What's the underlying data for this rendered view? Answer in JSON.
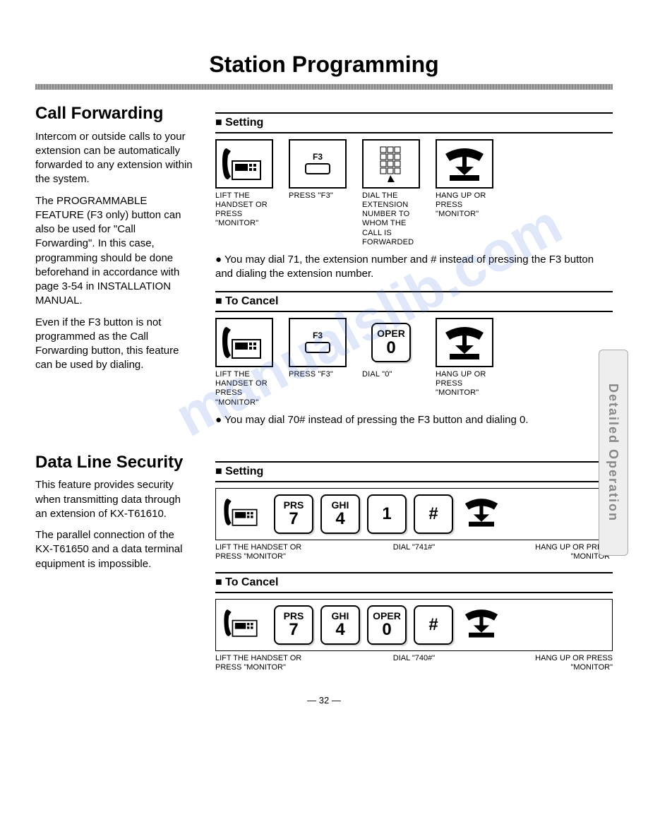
{
  "page_title": "Station Programming",
  "side_tab": "Detailed Operation",
  "watermark": "manualslib.com",
  "page_number": "— 32 —",
  "captions": {
    "lift_handset": "LIFT THE HANDSET OR PRESS \"MONITOR\"",
    "press_f3": "PRESS \"F3\"",
    "dial_ext": "DIAL THE EXTENSION NUMBER TO WHOM THE CALL IS FORWARDED",
    "hang_up": "HANG UP OR PRESS \"MONITOR\"",
    "dial_0": "DIAL \"0\"",
    "dial_741": "DIAL \"741#\"",
    "dial_740": "DIAL \"740#\""
  },
  "call_fwd": {
    "title": "Call Forwarding",
    "intro_p1": "Intercom or outside calls to your extension can be automatically forwarded to any extension within the system.",
    "intro_p2": "The PROGRAMMABLE FEATURE (F3 only) button can also be used for \"Call Forwarding\". In this case, programming should be done beforehand in accordance with page 3-54 in INSTALLATION MANUAL.",
    "intro_p3": "Even if the F3 button is not programmed as the Call Forwarding button, this feature can be used by dialing.",
    "setting_head": "Setting",
    "cancel_head": "To Cancel",
    "setting_note": "You may dial 71, the extension number and # instead of pressing the F3 button and dialing the extension number.",
    "cancel_note": "You may dial 70# instead of pressing the F3 button and dialing 0."
  },
  "data_line": {
    "title": "Data Line Security",
    "intro_p1": "This feature provides security when transmitting data through an extension of KX-T61610.",
    "intro_p2": "The parallel connection of the KX-T61650 and a data terminal equipment is impossible.",
    "setting_head": "Setting",
    "cancel_head": "To Cancel"
  },
  "keys": {
    "f3": "F3",
    "prs7_top": "PRS",
    "prs7_big": "7",
    "ghi4_top": "GHI",
    "ghi4_big": "4",
    "one_big": "1",
    "hash_big": "#",
    "oper0_top": "OPER",
    "oper0_big": "0"
  }
}
